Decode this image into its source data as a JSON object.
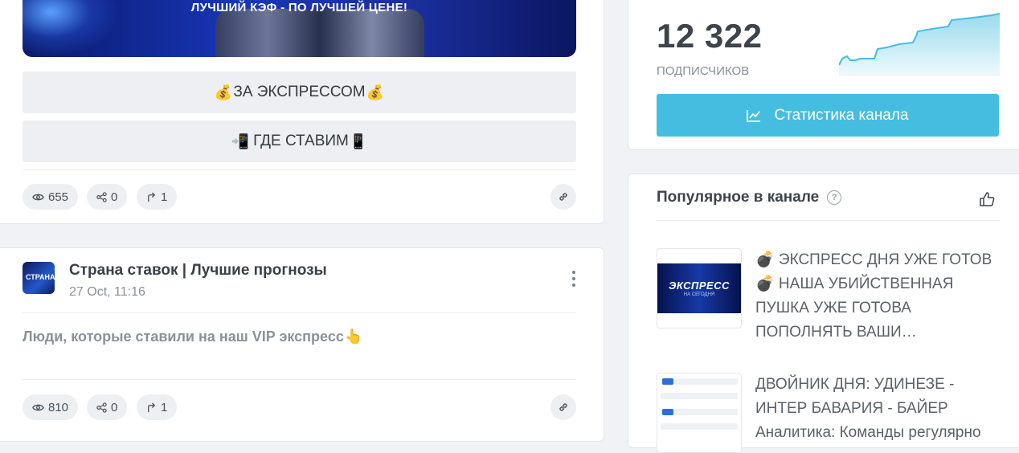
{
  "post1": {
    "banner_text": "ЛУЧШИЙ КЭФ - ПО ЛУЧШЕЙ ЦЕНЕ!",
    "button1": {
      "emoji_left": "💰",
      "label": "ЗА ЭКСПРЕССОМ",
      "emoji_right": "💰"
    },
    "button2": {
      "emoji_left": "📲",
      "label": "ГДЕ СТАВИМ",
      "emoji_right": "📱"
    },
    "views": "655",
    "shares": "0",
    "forwards": "1"
  },
  "post2": {
    "channel_name": "Страна ставок | Лучшие прогнозы",
    "avatar_text": "СТРАНА",
    "date": "27 Oct, 11:16",
    "text": "Люди, которые ставили на наш VIP экспресс",
    "text_emoji": "👆",
    "views": "810",
    "shares": "0",
    "forwards": "1"
  },
  "stats": {
    "subscribers": "12 322",
    "subscribers_label": "ПОДПИСЧИКОВ",
    "button_label": "Статистика канала",
    "accent_color": "#45bde0"
  },
  "popular": {
    "title": "Популярное в канале",
    "items": [
      {
        "thumb_title": "ЭКСПРЕСС",
        "thumb_sub": "НА СЕГОДНЯ",
        "text": "💣 ЭКСПРЕСС ДНЯ УЖЕ ГОТОВ 💣 НАША УБИЙСТВЕННАЯ ПУШКА УЖЕ ГОТОВА ПОПОЛНЯТЬ ВАШИ…"
      },
      {
        "text": "ДВОЙНИК ДНЯ: УДИНЕЗЕ - ИНТЕР БАВАРИЯ - БАЙЕР Аналитика: Команды регулярно"
      }
    ]
  },
  "icons": {
    "views": "eye-icon",
    "shares": "share-icon",
    "forwards": "forward-icon",
    "link": "link-icon",
    "more": "more-vertical-icon",
    "chart": "line-chart-icon",
    "help": "question-icon",
    "like": "thumbs-up-icon"
  }
}
